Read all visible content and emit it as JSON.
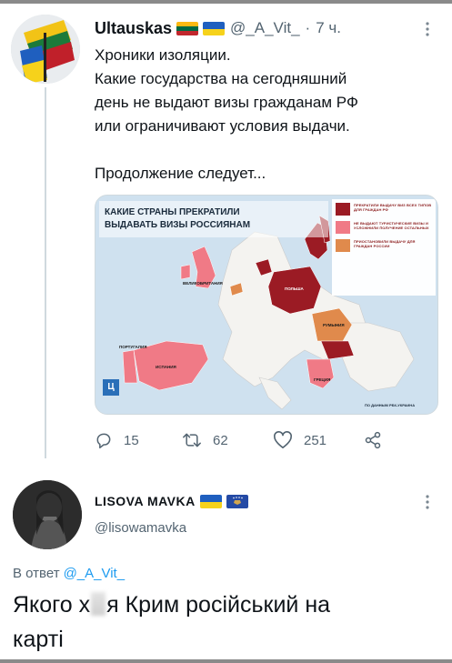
{
  "tweet": {
    "author_name": "Ultauskas",
    "author_handle": "@_A_Vit_",
    "dot": "·",
    "time": "7 ч.",
    "lines": [
      "Хроники изоляции.",
      "Какие  государства на сегодняшний",
      "день не выдают визы гражданам РФ",
      "или ограничивают условия выдачи.",
      "Продолжение следует..."
    ],
    "card": {
      "title_line1": "КАКИЕ СТРАНЫ ПРЕКРАТИЛИ",
      "title_line2": "ВЫДАВАТЬ ВИЗЫ РОССИЯНАМ",
      "legend": [
        {
          "text": "ПРЕКРАТИЛИ ВЫДАЧУ ВИЗ ВСЕХ ТИПОВ ДЛЯ ГРАЖДАН РФ",
          "color": "#9b1b24"
        },
        {
          "text": "НЕ ВЫДАЮТ ТУРИСТИЧЕСКИЕ ВИЗЫ И УСЛОЖНИЛИ ПОЛУЧЕНИЕ ОСТАЛЬНЫХ",
          "color": "#f07a86"
        },
        {
          "text": "ПРИОСТАНОВИЛИ ВЫДАЧУ ДЛЯ ГРАЖДАН РОССИИ",
          "color": "#e08a4c"
        }
      ],
      "country_labels": {
        "spain": "ИСПАНИЯ",
        "portugal": "ПОРТУГАЛИЯ",
        "uk": "ВЕЛИКОБРИТАНИЯ",
        "poland": "ПОЛЬША",
        "romania": "РУМЫНИЯ",
        "greece": "ГРЕЦИЯ"
      },
      "logo": "Ц",
      "source": "ПО ДАННЫМ РБК-УКРАИНА"
    },
    "actions": {
      "replies": "15",
      "retweets": "62",
      "likes": "251"
    }
  },
  "reply": {
    "author_name": "LISOVA MAVKA",
    "author_handle": "@lisowamavka",
    "reply_label": "В ответ",
    "reply_to": "@_A_Vit_",
    "text_before": "Якого х",
    "text_after": "я Крим російський на",
    "text_line2": "карті"
  },
  "colors": {
    "accent": "#1d9bf0",
    "muted": "#536471",
    "thread_line": "#cfd9de"
  }
}
